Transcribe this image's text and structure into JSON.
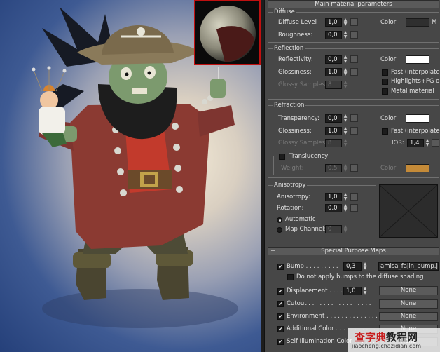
{
  "main_params": {
    "mark": "−",
    "title": "Main material parameters",
    "diffuse": {
      "title": "Diffuse",
      "diffuse_level_label": "Diffuse Level",
      "diffuse_level": "1,0",
      "color_label": "Color:",
      "map_label": "M",
      "color": "#2f2f2f",
      "roughness_label": "Roughness:",
      "roughness": "0,0"
    },
    "reflection": {
      "title": "Reflection",
      "reflectivity_label": "Reflectivity:",
      "reflectivity": "0,0",
      "color_label": "Color:",
      "color": "#ffffff",
      "glossiness_label": "Glossiness:",
      "glossiness": "1,0",
      "glossy_samples_label": "Glossy Samples:",
      "glossy_samples": "8",
      "fast_label": "Fast (interpolate)",
      "highlights_label": "Highlights+FG only",
      "metal_label": "Metal material"
    },
    "refraction": {
      "title": "Refraction",
      "transparency_label": "Transparency:",
      "transparency": "0,0",
      "color_label": "Color:",
      "color": "#ffffff",
      "glossiness_label": "Glossiness:",
      "glossiness": "1,0",
      "fast_label": "Fast (interpolate)",
      "glossy_samples_label": "Glossy Samples:",
      "glossy_samples": "8",
      "ior_label": "IOR:",
      "ior": "1,4",
      "translucency_label": "Translucency",
      "weight_label": "Weight:",
      "weight": "0,5",
      "trans_color_label": "Color:",
      "trans_color": "#c48a38"
    },
    "anisotropy": {
      "title": "Anisotropy",
      "anisotropy_label": "Anisotropy:",
      "anisotropy": "1,0",
      "rotation_label": "Rotation:",
      "rotation": "0,0",
      "automatic_label": "Automatic",
      "map_channel_label": "Map Channel:",
      "map_channel": "0"
    }
  },
  "special_maps": {
    "mark": "−",
    "title": "Special Purpose Maps",
    "bump_label": "Bump . . . . . . . . .",
    "bump_value": "0,3",
    "bump_map": "amisa_fajin_bump.jpg)",
    "no_bump_diffuse_label": "Do not apply bumps to the diffuse shading",
    "displacement_label": "Displacement . . . .",
    "displacement_value": "1,0",
    "cutout_label": "Cutout . . . . . . . . . . . . . . . . .",
    "environment_label": "Environment . . . . . . . . . . . . . .",
    "additional_color_label": "Additional Color . . . . . . . . . . .",
    "self_illum_label": "Self Illumination Color . . . . . . .",
    "none_label": "None"
  },
  "watermark": {
    "line1_a": "查字典",
    "line1_b": "教程网",
    "line2": "jiaocheng.chazidian.com"
  }
}
